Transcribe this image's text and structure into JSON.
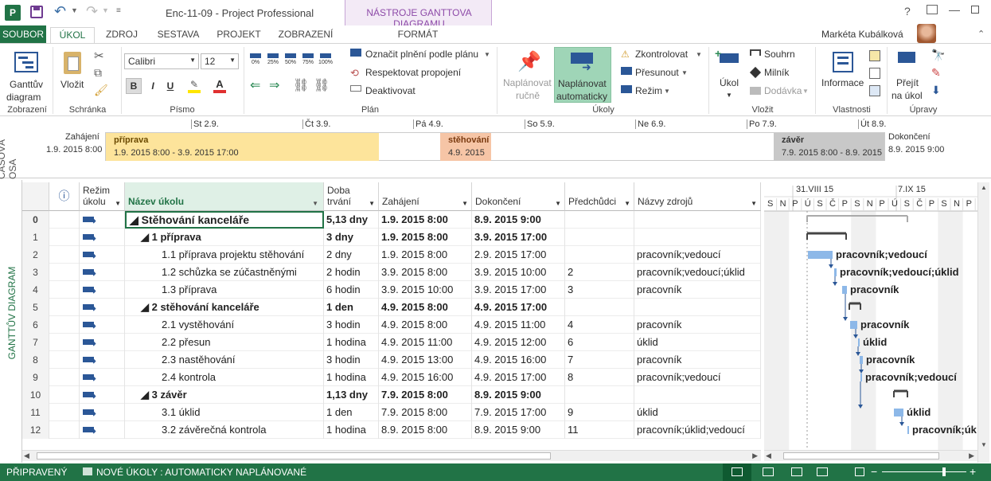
{
  "window": {
    "title": "Enc-11-09 - Project Professional",
    "context_tab": "NÁSTROJE GANTTOVA DIAGRAMU",
    "user": "Markéta Kubálková",
    "help": "?"
  },
  "tabs": [
    {
      "label": "SOUBOR"
    },
    {
      "label": "ÚKOL"
    },
    {
      "label": "ZDROJ"
    },
    {
      "label": "SESTAVA"
    },
    {
      "label": "PROJEKT"
    },
    {
      "label": "ZOBRAZENÍ"
    },
    {
      "label": "FORMÁT"
    }
  ],
  "ribbon": {
    "view": {
      "btn": "Ganttův diagram",
      "line1": "Ganttův",
      "line2": "diagram",
      "group": "Zobrazení"
    },
    "clipboard": {
      "paste": "Vložit",
      "group": "Schránka"
    },
    "font": {
      "name": "Calibri",
      "size": "12",
      "group": "Písmo",
      "b": "B",
      "i": "I",
      "u": "U"
    },
    "schedule": {
      "mark": "Označit plnění podle plánu",
      "respect": "Respektovat propojení",
      "deactivate": "Deaktivovat",
      "group": "Plán",
      "pct": [
        "0%",
        "25%",
        "50%",
        "75%",
        "100%"
      ]
    },
    "tasks": {
      "manual1": "Naplánovat",
      "manual2": "ručně",
      "auto1": "Naplánovat",
      "auto2": "automaticky",
      "inspect": "Zkontrolovat",
      "move": "Přesunout",
      "mode": "Režim",
      "group": "Úkoly"
    },
    "insert": {
      "task": "Úkol",
      "summary": "Souhrn",
      "milestone": "Milník",
      "deliverable": "Dodávka",
      "group": "Vložit"
    },
    "properties": {
      "info": "Informace",
      "group": "Vlastnosti"
    },
    "editing": {
      "goto1": "Přejít",
      "goto2": "na úkol",
      "group": "Úpravy"
    }
  },
  "timeline": {
    "side_label": "ČASOVÁ OSA",
    "start_label": "Zahájení",
    "start_value": "1.9. 2015 8:00",
    "end_label": "Dokončení",
    "end_value": "8.9. 2015 9:00",
    "ticks": [
      "St 2.9.",
      "Čt 3.9.",
      "Pá 4.9.",
      "So 5.9.",
      "Ne 6.9.",
      "Po 7.9.",
      "Út 8.9."
    ],
    "bars": [
      {
        "name": "příprava",
        "dates": "1.9. 2015 8:00 - 3.9. 2015 17:00",
        "color": "#fde49b"
      },
      {
        "name": "stěhování",
        "dates": "4.9. 2015",
        "color": "#f6c5a6"
      },
      {
        "name": "závěr",
        "dates": "7.9. 2015 8:00 - 8.9. 2015",
        "color": "#c8c8c8"
      }
    ]
  },
  "side_label": "GANTTŮV DIAGRAM",
  "grid": {
    "headers": {
      "info": "ⓘ",
      "mode1": "Režim",
      "mode2": "úkolu",
      "name": "Název úkolu",
      "dur1": "Doba",
      "dur2": "trvání",
      "start": "Zahájení",
      "finish": "Dokončení",
      "pred": "Předchůdci",
      "res": "Názvy zdrojů"
    },
    "rows": [
      {
        "id": "0",
        "name": "◢ Stěhování kanceláře",
        "dur": "5,13 dny",
        "start": "1.9. 2015 8:00",
        "finish": "8.9. 2015 9:00",
        "pred": "",
        "res": "",
        "level": 0,
        "summary": true
      },
      {
        "id": "1",
        "name": "◢ 1 příprava",
        "dur": "3 dny",
        "start": "1.9. 2015 8:00",
        "finish": "3.9. 2015 17:00",
        "pred": "",
        "res": "",
        "level": 1,
        "summary": true
      },
      {
        "id": "2",
        "name": "1.1 příprava projektu stěhování",
        "dur": "2 dny",
        "start": "1.9. 2015 8:00",
        "finish": "2.9. 2015 17:00",
        "pred": "",
        "res": "pracovník;vedoucí",
        "level": 2,
        "summary": false
      },
      {
        "id": "3",
        "name": "1.2 schůzka se zúčastněnými",
        "dur": "2 hodin",
        "start": "3.9. 2015 8:00",
        "finish": "3.9. 2015 10:00",
        "pred": "2",
        "res": "pracovník;vedoucí;úklid",
        "level": 2,
        "summary": false
      },
      {
        "id": "4",
        "name": "1.3 příprava",
        "dur": "6 hodin",
        "start": "3.9. 2015 10:00",
        "finish": "3.9. 2015 17:00",
        "pred": "3",
        "res": "pracovník",
        "level": 2,
        "summary": false
      },
      {
        "id": "5",
        "name": "◢ 2 stěhování kanceláře",
        "dur": "1 den",
        "start": "4.9. 2015 8:00",
        "finish": "4.9. 2015 17:00",
        "pred": "",
        "res": "",
        "level": 1,
        "summary": true
      },
      {
        "id": "6",
        "name": "2.1 vystěhování",
        "dur": "3 hodin",
        "start": "4.9. 2015 8:00",
        "finish": "4.9. 2015 11:00",
        "pred": "4",
        "res": "pracovník",
        "level": 2,
        "summary": false
      },
      {
        "id": "7",
        "name": "2.2 přesun",
        "dur": "1 hodina",
        "start": "4.9. 2015 11:00",
        "finish": "4.9. 2015 12:00",
        "pred": "6",
        "res": "úklid",
        "level": 2,
        "summary": false
      },
      {
        "id": "8",
        "name": "2.3 nastěhování",
        "dur": "3 hodin",
        "start": "4.9. 2015 13:00",
        "finish": "4.9. 2015 16:00",
        "pred": "7",
        "res": "pracovník",
        "level": 2,
        "summary": false
      },
      {
        "id": "9",
        "name": "2.4 kontrola",
        "dur": "1 hodina",
        "start": "4.9. 2015 16:00",
        "finish": "4.9. 2015 17:00",
        "pred": "8",
        "res": "pracovník;vedoucí",
        "level": 2,
        "summary": false
      },
      {
        "id": "10",
        "name": "◢ 3 závěr",
        "dur": "1,13 dny",
        "start": "7.9. 2015 8:00",
        "finish": "8.9. 2015 9:00",
        "pred": "",
        "res": "",
        "level": 1,
        "summary": true
      },
      {
        "id": "11",
        "name": "3.1 úklid",
        "dur": "1 den",
        "start": "7.9. 2015 8:00",
        "finish": "7.9. 2015 17:00",
        "pred": "9",
        "res": "úklid",
        "level": 2,
        "summary": false
      },
      {
        "id": "12",
        "name": "3.2 závěrečná kontrola",
        "dur": "1 hodina",
        "start": "8.9. 2015 8:00",
        "finish": "8.9. 2015 9:00",
        "pred": "11",
        "res": "pracovník;úklid;vedoucí",
        "level": 2,
        "summary": false
      }
    ]
  },
  "gantt": {
    "weeks": [
      "31.VIII 15",
      "7.IX 15"
    ],
    "days": [
      "S",
      "N",
      "P",
      "Ú",
      "S",
      "Č",
      "P",
      "S",
      "N",
      "P",
      "Ú",
      "S",
      "Č",
      "P",
      "S",
      "N",
      "P"
    ],
    "bar_labels": [
      "pracovník;vedoucí",
      "pracovník;vedoucí;úklid",
      "pracovník",
      "pracovník",
      "úklid",
      "pracovník",
      "pracovník;vedoucí",
      "úklid",
      "pracovník;úk"
    ]
  },
  "status": {
    "ready": "PŘIPRAVENÝ",
    "new_tasks": "NOVÉ ÚKOLY : AUTOMATICKY NAPLÁNOVANÉ"
  },
  "colors": {
    "accent": "#217346",
    "bar": "#8db8e8",
    "context": "#8d4aa8"
  }
}
